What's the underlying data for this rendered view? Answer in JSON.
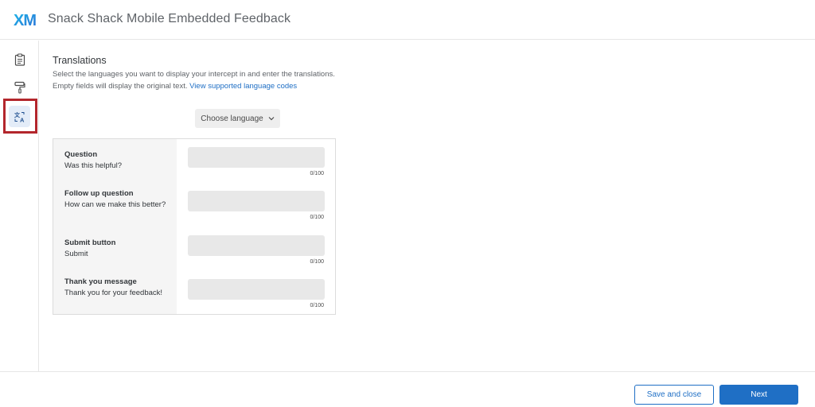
{
  "header": {
    "logo_text": "XM",
    "title": "Snack Shack Mobile Embedded Feedback"
  },
  "rail": {
    "items": [
      {
        "icon": "clipboard-icon",
        "active": false
      },
      {
        "icon": "paint-roller-icon",
        "active": false
      },
      {
        "icon": "translate-icon",
        "active": true
      }
    ]
  },
  "translations": {
    "title": "Translations",
    "description": "Select the languages you want to display your intercept in and enter the translations. Empty fields will display the original text.",
    "link_text": "View supported language codes",
    "choose_language": "Choose language",
    "rows": [
      {
        "label": "Question",
        "text": "Was this helpful?",
        "count": "0/100",
        "value": ""
      },
      {
        "label": "Follow up question",
        "text": "How can we make this better?",
        "count": "0/100",
        "value": ""
      },
      {
        "label": "Submit button",
        "text": "Submit",
        "count": "0/100",
        "value": ""
      },
      {
        "label": "Thank you message",
        "text": "Thank you for your feedback!",
        "count": "0/100",
        "value": ""
      }
    ]
  },
  "footer": {
    "save_close": "Save and close",
    "next": "Next"
  },
  "colors": {
    "accent": "#1f6fc5",
    "highlight": "#b3262c",
    "logo_gradient_start": "#1fb7e8",
    "logo_gradient_end": "#2a6fd6"
  }
}
